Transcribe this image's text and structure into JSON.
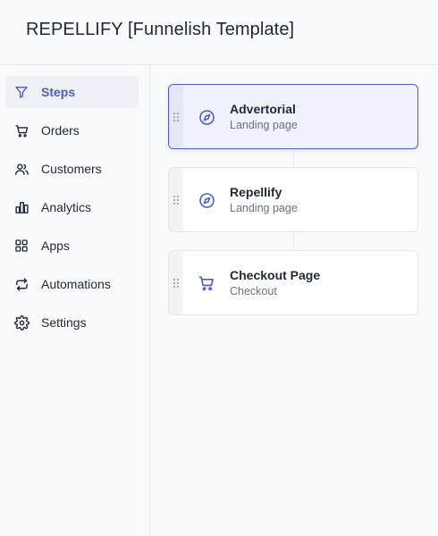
{
  "header": {
    "title": "REPELLIFY [Funnelish Template]"
  },
  "sidebar": {
    "items": [
      {
        "label": "Steps",
        "icon": "filter-icon",
        "active": true
      },
      {
        "label": "Orders",
        "icon": "cart-icon"
      },
      {
        "label": "Customers",
        "icon": "users-icon"
      },
      {
        "label": "Analytics",
        "icon": "bar-chart-icon"
      },
      {
        "label": "Apps",
        "icon": "grid-icon"
      },
      {
        "label": "Automations",
        "icon": "repeat-icon"
      },
      {
        "label": "Settings",
        "icon": "gear-icon"
      }
    ]
  },
  "steps": [
    {
      "title": "Advertorial",
      "subtitle": "Landing page",
      "icon": "compass-icon",
      "selected": true
    },
    {
      "title": "Repellify",
      "subtitle": "Landing page",
      "icon": "compass-icon"
    },
    {
      "title": "Checkout Page",
      "subtitle": "Checkout",
      "icon": "cart-icon"
    }
  ],
  "colors": {
    "accent": "#4a5fc1",
    "active_bg": "#eef0f6",
    "text": "#1f2937",
    "muted": "#6b7280",
    "border": "#e5e7eb"
  }
}
